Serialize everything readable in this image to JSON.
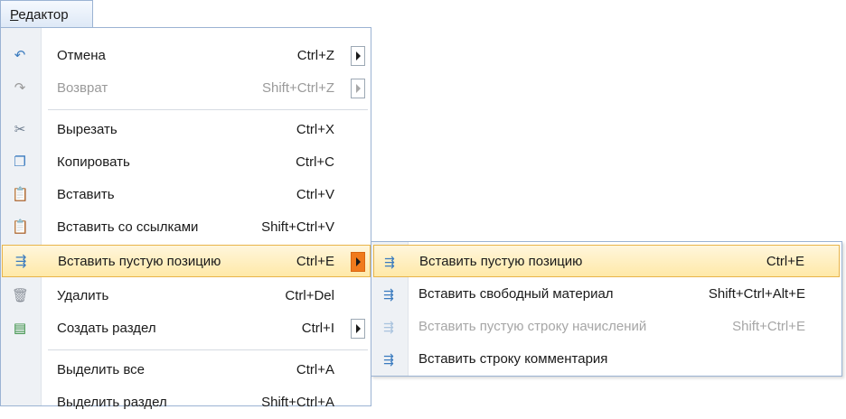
{
  "menubar": {
    "title": "Редактор"
  },
  "menu": {
    "items": [
      {
        "label": "Отмена",
        "shortcut": "Ctrl+Z",
        "icon": "undo-icon"
      },
      {
        "label": "Возврат",
        "shortcut": "Shift+Ctrl+Z",
        "icon": "redo-icon"
      },
      {
        "label": "Вырезать",
        "shortcut": "Ctrl+X",
        "icon": "cut-icon"
      },
      {
        "label": "Копировать",
        "shortcut": "Ctrl+C",
        "icon": "copy-icon"
      },
      {
        "label": "Вставить",
        "shortcut": "Ctrl+V",
        "icon": "paste-icon"
      },
      {
        "label": "Вставить со ссылками",
        "shortcut": "Shift+Ctrl+V",
        "icon": "paste-links-icon"
      },
      {
        "label": "Вставить пустую позицию",
        "shortcut": "Ctrl+E",
        "icon": "insert-position-icon"
      },
      {
        "label": "Удалить",
        "shortcut": "Ctrl+Del",
        "icon": "trash-icon"
      },
      {
        "label": "Создать раздел",
        "shortcut": "Ctrl+I",
        "icon": "create-section-icon"
      },
      {
        "label": "Выделить все",
        "shortcut": "Ctrl+A",
        "icon": ""
      },
      {
        "label": "Выделить раздел",
        "shortcut": "Shift+Ctrl+A",
        "icon": ""
      }
    ]
  },
  "submenu": {
    "items": [
      {
        "label": "Вставить пустую позицию",
        "shortcut": "Ctrl+E",
        "icon": "insert-position-icon"
      },
      {
        "label": "Вставить свободный материал",
        "shortcut": "Shift+Ctrl+Alt+E",
        "icon": "insert-material-icon"
      },
      {
        "label": "Вставить пустую строку начислений",
        "shortcut": "Shift+Ctrl+E",
        "icon": "insert-charges-row-icon"
      },
      {
        "label": "Вставить строку комментария",
        "shortcut": "",
        "icon": "insert-comment-row-icon"
      }
    ]
  },
  "colors": {
    "highlight": "#ffe9a8",
    "highlight_border": "#e8b44a",
    "submenu_arrow_active": "#f07a1c",
    "border": "#9bb3d3"
  }
}
